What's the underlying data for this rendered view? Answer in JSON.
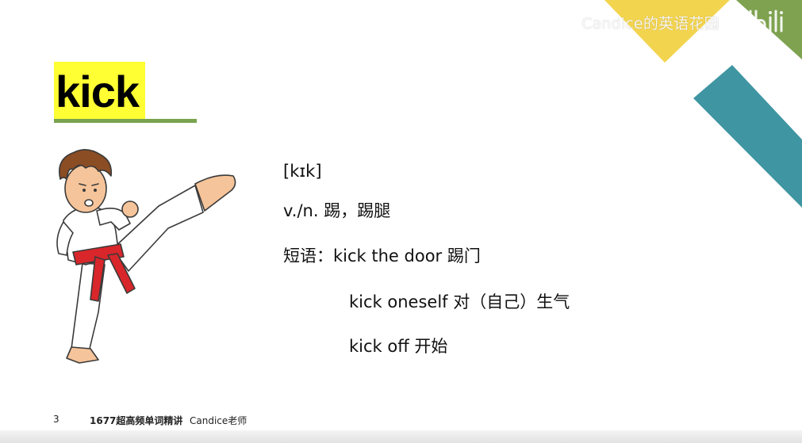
{
  "watermark": {
    "channel_text": "Candice的英语花园",
    "logo": "bilibili-logo"
  },
  "colors": {
    "highlight_yellow": "#ffff33",
    "underline_green": "#7aa34e",
    "deco_yellow": "#f3d44f",
    "deco_green": "#7ea24f",
    "deco_teal": "#3f95a2",
    "belt_red": "#d8262b"
  },
  "word": {
    "headword": "kick"
  },
  "entry": {
    "phonetic": "[kɪk]",
    "definition": "v./n. 踢，踢腿",
    "phrases_label": "短语：",
    "phrases": [
      {
        "text": "kick the door 踢门"
      },
      {
        "text": "kick oneself 对（自己）生气"
      },
      {
        "text": "kick off 开始"
      }
    ]
  },
  "illustration": {
    "icon": "karate-kick-boy-illustration"
  },
  "footer": {
    "page_number": "3",
    "course_title": "1677超高频单词精讲",
    "teacher": "Candice老师"
  }
}
